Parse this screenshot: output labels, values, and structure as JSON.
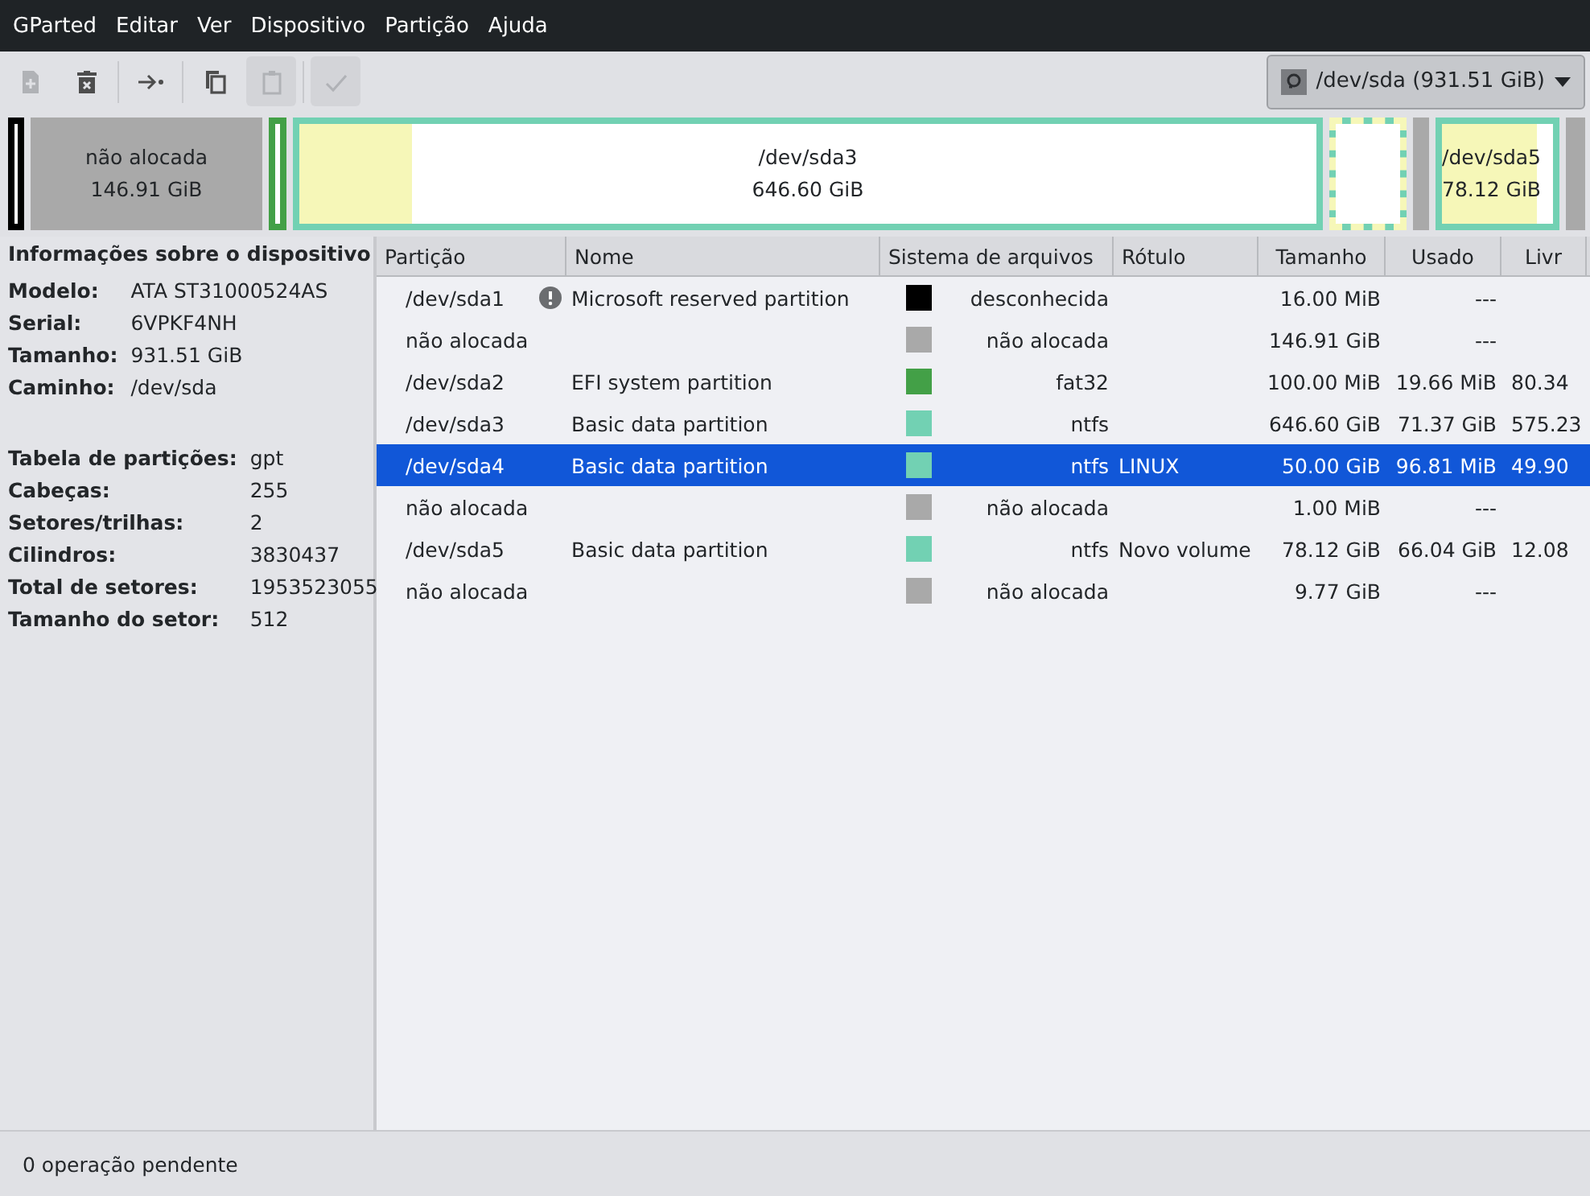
{
  "menu": [
    "GParted",
    "Editar",
    "Ver",
    "Dispositivo",
    "Partição",
    "Ajuda"
  ],
  "toolbar": [
    {
      "kind": "new",
      "disabled": true
    },
    {
      "kind": "delete",
      "disabled": false
    },
    {
      "kind": "sep"
    },
    {
      "kind": "resize",
      "disabled": false
    },
    {
      "kind": "sep"
    },
    {
      "kind": "copy",
      "disabled": false
    },
    {
      "kind": "paste",
      "disabled": true
    },
    {
      "kind": "sep"
    },
    {
      "kind": "apply",
      "disabled": true
    }
  ],
  "device_selector": "/dev/sda (931.51 GiB)",
  "disk_map": [
    {
      "color": "#000000",
      "selected": false
    },
    {
      "color": "#a9a9a9",
      "selected": false,
      "lines": [
        "não alocada",
        "146.91 GiB"
      ]
    },
    {
      "color": "#43a047",
      "selected": false
    },
    {
      "color": "#72d1b3",
      "selected": false,
      "level": 0.11,
      "lines": [
        "/dev/sda3",
        "646.60 GiB"
      ]
    },
    {
      "color": "#72d1b3",
      "selected": true
    },
    {
      "color": "#a9a9a9",
      "selected": false
    },
    {
      "color": "#72d1b3",
      "selected": false,
      "level": 0.85,
      "lines": [
        "/dev/sda5",
        "78.12 GiB"
      ]
    },
    {
      "color": "#a9a9a9",
      "selected": false
    }
  ],
  "device_info": {
    "title": "Informações sobre o dispositivo",
    "groups": [
      [
        [
          "Modelo:",
          "ATA ST31000524AS"
        ],
        [
          "Serial:",
          "6VPKF4NH"
        ],
        [
          "Tamanho:",
          "931.51 GiB"
        ],
        [
          "Caminho:",
          "/dev/sda"
        ]
      ],
      [
        [
          "Tabela de partições:",
          "gpt"
        ],
        [
          "Cabeças:",
          "255"
        ],
        [
          "Setores/trilhas:",
          "2"
        ],
        [
          "Cilindros:",
          "3830437"
        ],
        [
          "Total de setores:",
          "1953523055"
        ],
        [
          "Tamanho do setor:",
          "512"
        ]
      ]
    ]
  },
  "table": {
    "columns": [
      "Partição",
      "Nome",
      "Sistema de arquivos",
      "Rótulo",
      "Tamanho",
      "Usado",
      "Livr"
    ],
    "rows": [
      {
        "partition": "/dev/sda1",
        "warning": true,
        "name": "Microsoft reserved partition",
        "color": "#000000",
        "filesystem": "desconhecida",
        "label": "",
        "size": "16.00 MiB",
        "used": "---",
        "free": "",
        "selected": false
      },
      {
        "partition": "não alocada",
        "warning": false,
        "name": "",
        "color": "#a9a9a9",
        "filesystem": "não alocada",
        "label": "",
        "size": "146.91 GiB",
        "used": "---",
        "free": "",
        "selected": false
      },
      {
        "partition": "/dev/sda2",
        "warning": false,
        "name": "EFI system partition",
        "color": "#43a047",
        "filesystem": "fat32",
        "label": "",
        "size": "100.00 MiB",
        "used": "19.66 MiB",
        "free": "80.34",
        "selected": false
      },
      {
        "partition": "/dev/sda3",
        "warning": false,
        "name": "Basic data partition",
        "color": "#72d1b3",
        "filesystem": "ntfs",
        "label": "",
        "size": "646.60 GiB",
        "used": "71.37 GiB",
        "free": "575.23",
        "selected": false
      },
      {
        "partition": "/dev/sda4",
        "warning": false,
        "name": "Basic data partition",
        "color": "#72d1b3",
        "filesystem": "ntfs",
        "label": "LINUX",
        "size": "50.00 GiB",
        "used": "96.81 MiB",
        "free": "49.90",
        "selected": true
      },
      {
        "partition": "não alocada",
        "warning": false,
        "name": "",
        "color": "#a9a9a9",
        "filesystem": "não alocada",
        "label": "",
        "size": "1.00 MiB",
        "used": "---",
        "free": "",
        "selected": false
      },
      {
        "partition": "/dev/sda5",
        "warning": false,
        "name": "Basic data partition",
        "color": "#72d1b3",
        "filesystem": "ntfs",
        "label": "Novo volume",
        "size": "78.12 GiB",
        "used": "66.04 GiB",
        "free": "12.08",
        "selected": false
      },
      {
        "partition": "não alocada",
        "warning": false,
        "name": "",
        "color": "#a9a9a9",
        "filesystem": "não alocada",
        "label": "",
        "size": "9.77 GiB",
        "used": "---",
        "free": "",
        "selected": false
      }
    ]
  },
  "status_bar": "0 operação pendente"
}
